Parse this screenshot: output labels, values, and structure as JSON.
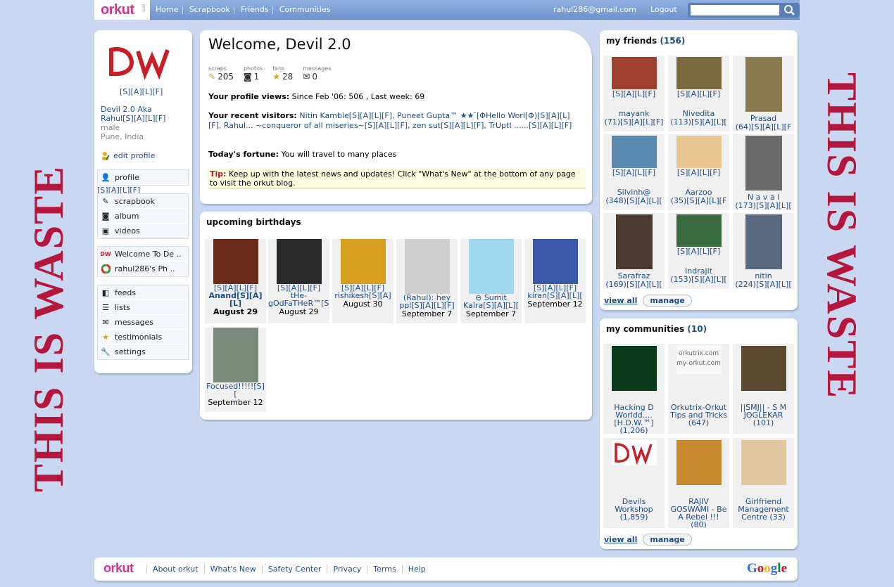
{
  "topbar": {
    "logo": "orkut",
    "beta": "BETA",
    "nav": [
      "Home",
      "Scrapbook",
      "Friends",
      "Communities"
    ],
    "email": "rahul286@gmail.com",
    "logout": "Logout",
    "search_value": ""
  },
  "watermark": {
    "text": "THIS IS WASTE"
  },
  "left": {
    "avatar_text": "DW",
    "sfl": "[S][A][L][F]",
    "name_line1": "Devil 2.0 Aka",
    "name_line2": "Rahul[S][A][L][F]",
    "gender": "male",
    "location": "Pune, India",
    "edit_profile": "edit profile",
    "menu1": [
      {
        "label": "profile",
        "icon": "user-icon"
      },
      {
        "label": "scrapbook",
        "icon": "pencil-icon"
      },
      {
        "label": "album",
        "icon": "camera-icon"
      },
      {
        "label": "videos",
        "icon": "film-icon"
      }
    ],
    "profile_sub": "[S][A][L][F]",
    "apps": [
      {
        "label": "Welcome To De ..",
        "icon": "dw-app-icon"
      },
      {
        "label": "rahul286's Ph ..",
        "icon": "colorful-circle-icon"
      }
    ],
    "menu2": [
      {
        "label": "feeds",
        "icon": "feed-icon"
      },
      {
        "label": "lists",
        "icon": "list-icon"
      },
      {
        "label": "messages",
        "icon": "envelope-icon"
      },
      {
        "label": "testimonials",
        "icon": "star-icon"
      },
      {
        "label": "settings",
        "icon": "wrench-icon"
      }
    ]
  },
  "welcome": {
    "title": "Welcome, Devil 2.0",
    "stats": [
      {
        "label": "scraps",
        "value": "205",
        "icon": "scrap-icon"
      },
      {
        "label": "photos",
        "value": "1",
        "icon": "photo-icon"
      },
      {
        "label": "fans",
        "value": "28",
        "icon": "star-icon"
      },
      {
        "label": "messages",
        "value": "0",
        "icon": "envelope-icon"
      }
    ],
    "views_label": "Your profile views:",
    "views_text": " Since Feb '06: 506 , Last week: 69",
    "visitors_label": "Your recent visitors:",
    "visitors_text": " Nitin Kamble[S][A][L][F], Puneet Gupta™ ★★ ̄[ΦHello Worl[Φ)[S][A][L][F], Rahul... ~conqueror of all miseries~[S][A][L][F], zen sut[S][A][L][F], TrUptI ......[S][A][L][F]",
    "fortune_label": "Today's fortune:",
    "fortune_text": " You will travel to many places",
    "tip_label": "Tip:",
    "tip_text": " Keep up with the latest news and updates! Click \"What's New\" at the bottom of any page to visit the orkut blog."
  },
  "birthdays": {
    "title": "upcoming birthdays",
    "items": [
      {
        "sfl": "[S][A][L][F]",
        "name": "Anand[S][A][L]",
        "date": "August 29",
        "color": "#6b2a1a"
      },
      {
        "sfl": "[S][A][L][F]",
        "name": "tHe-gOdFaTHeR™[S][A][L][F]",
        "date": "August 29",
        "color": "#2a2a2a"
      },
      {
        "sfl": "[S][A][L][F]",
        "name": "rishikesh[S][A]",
        "date": "August 30",
        "color": "#d8a020"
      },
      {
        "sfl": "",
        "name": "(Rahul): hey ppl[S][A][L][F]",
        "date": "September 7",
        "color": "#cfcfcf"
      },
      {
        "sfl": "",
        "name": "⊖ Sumit Kalra[S][A][L][",
        "date": "September 7",
        "color": "#9ed7ee"
      },
      {
        "sfl": "[S][A][L][F]",
        "name": "kiran[S][A][L][",
        "date": "September 12",
        "color": "#3a58a8"
      },
      {
        "sfl": "",
        "name": "Focused!!!!![S][",
        "date": "September 12",
        "color": "#7a8a7a"
      }
    ]
  },
  "friends": {
    "title": "my friends",
    "count": "(156)",
    "items": [
      {
        "name": "mayank",
        "sub": "(71)[S][A][L][F]",
        "sfl": "[S][A][L][F]",
        "color": "#a04030"
      },
      {
        "name": "Nivedita",
        "sub": "(113)[S][A][L][",
        "sfl": "[S][A][L][F]",
        "color": "#7a6a40"
      },
      {
        "name": "Prasad",
        "sub": "(64)[S][A][L][F",
        "sfl": "",
        "color": "#8a7a50"
      },
      {
        "name": "Silvinh@",
        "sub": "(348)[S][A][L][",
        "sfl": "[S][A][L][F]",
        "color": "#5a8ab0"
      },
      {
        "name": "Aarzoo",
        "sub": "(35)[S][A][L][F",
        "sfl": "[S][A][L][F]",
        "color": "#e8c890"
      },
      {
        "name": "N a v a l",
        "sub": "(173)[S][A][L][",
        "sfl": "",
        "color": "#6a6a6a"
      },
      {
        "name": "Sarafraz",
        "sub": "(169)[S][A][L][",
        "sfl": "",
        "color": "#4a3a30"
      },
      {
        "name": "Indrajit",
        "sub": "(153)[S][A][L][",
        "sfl": "[S][A][L][F]",
        "color": "#3a6a40"
      },
      {
        "name": "nitin",
        "sub": "(224)[S][A][L][",
        "sfl": "",
        "color": "#5a6a80"
      }
    ],
    "view_all": "view all",
    "manage": "manage"
  },
  "communities": {
    "title": "my communities",
    "count": "(10)",
    "items": [
      {
        "name": "Hacking D Worldd....[H.D.W.™] (1,206)",
        "color": "#0a3a1a"
      },
      {
        "name": "Orkutrix-Orkut Tips and Tricks (647)",
        "color": "#f8f8f8"
      },
      {
        "name": "||SMJ|| - S M JOGLEKAR (101)",
        "color": "#5a4a30"
      },
      {
        "name": "Devils Workshop (1,859)",
        "color": "#ffffff"
      },
      {
        "name": "RAJIV GOSWAMI - Be A Rebel !!! (80)",
        "color": "#c88a30"
      },
      {
        "name": "Girlfriend Management Centre (33)",
        "color": "#e0c8a0"
      }
    ],
    "thumb_text_orkutrix": "orkutrix.com my-orkut.com",
    "view_all": "view all",
    "manage": "manage"
  },
  "footer": {
    "logo": "orkut",
    "links": [
      "About orkut",
      "What's New",
      "Safety Center",
      "Privacy",
      "Terms",
      "Help"
    ],
    "google": "Google"
  },
  "colors": {
    "accent": "#1c4c90",
    "brand": "#d6338a",
    "watermark": "#b5163c"
  }
}
